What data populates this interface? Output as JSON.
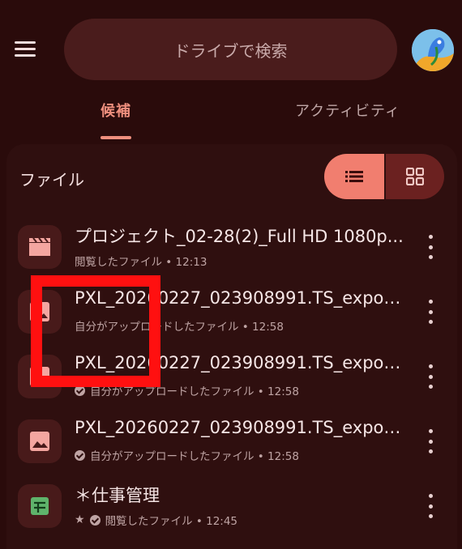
{
  "header": {
    "search_placeholder": "ドライブで検索",
    "menu_icon": "hamburger-menu-icon",
    "avatar_icon": "bird-avatar-icon"
  },
  "tabs": {
    "suggested": "候補",
    "activity": "アクティビティ"
  },
  "files_section": {
    "title": "ファイル",
    "list_view_icon": "list-view-icon",
    "grid_view_icon": "grid-view-icon"
  },
  "files": [
    {
      "name": "プロジェクト_02-28(2)_Full HD 1080p...",
      "meta": "閲覧したファイル • 12:13",
      "icon": "video-clapper-icon",
      "icon_color": "#f4a6a0"
    },
    {
      "name": "PXL_20260227_023908991.TS_export...",
      "meta": "自分がアップロードしたファイル • 12:58",
      "icon": "image-icon",
      "icon_color": "#f4a6a0"
    },
    {
      "name": "PXL_20260227_023908991.TS_export...",
      "meta": "自分がアップロードしたファイル • 12:58",
      "icon": "image-icon",
      "icon_color": "#f4a6a0"
    },
    {
      "name": "PXL_20260227_023908991.TS_export...",
      "meta": "自分がアップロードしたファイル • 12:58",
      "icon": "image-icon",
      "icon_color": "#f4a6a0"
    },
    {
      "name": "＊仕事管理",
      "meta": "閲覧したファイル • 12:45",
      "icon": "spreadsheet-icon",
      "icon_color": "#5fb36b"
    }
  ],
  "colors": {
    "background": "#2a0b0b",
    "accent": "#ef8f7e",
    "annotation": "#ff1010"
  }
}
